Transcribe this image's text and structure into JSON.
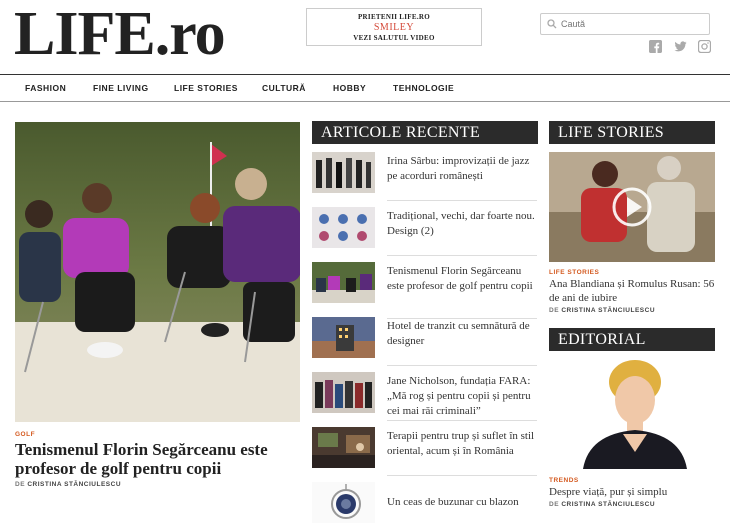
{
  "logo": {
    "main": "LIFE",
    "dot": ".ro"
  },
  "promo": {
    "line1": "PRIETENII LIFE.RO",
    "line2": "SMILEY",
    "line3": "VEZI SALUTUL VIDEO"
  },
  "search": {
    "placeholder": "Caută"
  },
  "social": [
    "facebook-icon",
    "twitter-icon",
    "instagram-icon"
  ],
  "nav": [
    "FASHION",
    "FINE LIVING",
    "LIFE STORIES",
    "CULTURĂ",
    "HOBBY",
    "TEHNOLOGIE"
  ],
  "hero": {
    "category": "GOLF",
    "title": "Tenismenul Florin Segărceanu este profesor de golf pentru copii",
    "by_prefix": "DE",
    "author": "CRISTINA STĂNCIULESCU"
  },
  "recent": {
    "heading": "ARTICOLE RECENTE",
    "items": [
      {
        "title": "Irina Sârbu: improvizații de jazz pe acorduri românești"
      },
      {
        "title": "Tradițional, vechi, dar foarte nou. Design (2)"
      },
      {
        "title": "Tenismenul Florin Segărceanu este profesor de golf pentru copii"
      },
      {
        "title": "Hotel de tranzit cu semnătură de designer"
      },
      {
        "title": "Jane Nicholson, fundația FARA: „Mă rog și pentru copii și pentru cei mai răi criminali”"
      },
      {
        "title": "Terapii pentru trup și suflet în stil oriental, acum și în România"
      },
      {
        "title": "Un ceas de buzunar cu blazon"
      }
    ]
  },
  "life_stories": {
    "heading": "LIFE STORIES",
    "category": "LIFE STORIES",
    "title": "Ana Blandiana și Romulus Rusan: 56 de ani de iubire",
    "by_prefix": "DE",
    "author": "CRISTINA STĂNCIULESCU"
  },
  "editorial": {
    "heading": "EDITORIAL",
    "category": "TRENDS",
    "title": "Despre viață, pur și simplu",
    "by_prefix": "DE",
    "author": "CRISTINA STĂNCIULESCU"
  }
}
